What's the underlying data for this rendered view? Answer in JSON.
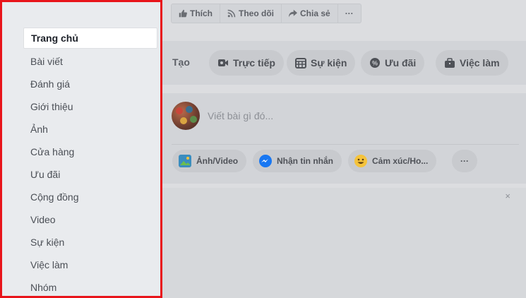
{
  "sidebar": {
    "items": [
      {
        "label": "Trang chủ",
        "active": true
      },
      {
        "label": "Bài viết"
      },
      {
        "label": "Đánh giá"
      },
      {
        "label": "Giới thiệu"
      },
      {
        "label": "Ảnh"
      },
      {
        "label": "Cửa hàng"
      },
      {
        "label": "Ưu đãi"
      },
      {
        "label": "Cộng đồng"
      },
      {
        "label": "Video"
      },
      {
        "label": "Sự kiện"
      },
      {
        "label": "Việc làm"
      },
      {
        "label": "Nhóm"
      }
    ]
  },
  "page_actions": {
    "like": "Thích",
    "follow": "Theo dõi",
    "share": "Chia sẻ",
    "more": "···"
  },
  "create": {
    "label": "Tạo",
    "live": "Trực tiếp",
    "event": "Sự kiện",
    "offer": "Ưu đãi",
    "job": "Việc làm"
  },
  "composer": {
    "placeholder": "Viết bài gì đó...",
    "photo_video": "Ảnh/Video",
    "message": "Nhận tin nhắn",
    "feeling": "Cảm xúc/Ho...",
    "more": "···"
  },
  "feed": {
    "close": "×"
  },
  "colors": {
    "highlight_border": "#e8141a",
    "messenger_blue": "#1877f2",
    "emoji_yellow": "#f5c33b"
  }
}
